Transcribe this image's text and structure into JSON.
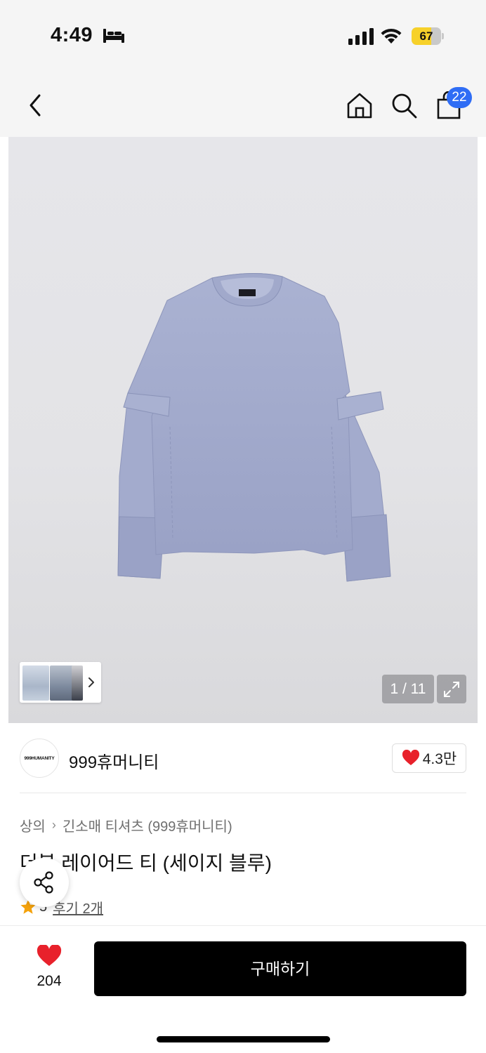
{
  "status_bar": {
    "time": "4:49",
    "battery": "67",
    "battery_level_percent": 67,
    "icons": [
      "bed-icon",
      "signal-icon",
      "wifi-icon",
      "battery-icon"
    ]
  },
  "nav": {
    "icons": [
      "back-icon",
      "home-icon",
      "search-icon",
      "shopping-bag-icon"
    ],
    "cart_count": "22",
    "badge_color": "#2f6df5"
  },
  "gallery": {
    "page_counter": "1 / 11",
    "current_page": 1,
    "total_pages": 11
  },
  "brand": {
    "logo_text": "999HUMANITY",
    "name": "999휴머니티",
    "likes": "4.3만"
  },
  "breadcrumb": {
    "category": "상의",
    "subcategory": "긴소매 티셔츠 (999휴머니티)"
  },
  "product": {
    "title": "더블 레이어드 티 (세이지 블루)",
    "rating": "5",
    "review_link": "후기 2개"
  },
  "bottom": {
    "wish_count": "204",
    "buy_label": "구매하기",
    "accent_color": "#e8212b"
  }
}
